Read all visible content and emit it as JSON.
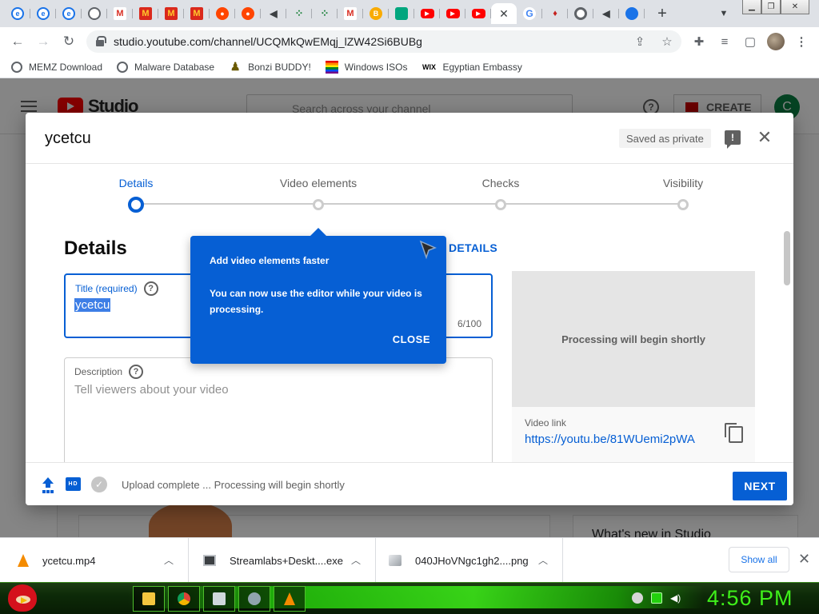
{
  "browser": {
    "tabs": [
      {
        "icon": "ie-icon"
      },
      {
        "icon": "ie-icon"
      },
      {
        "icon": "ie-icon"
      },
      {
        "icon": "globe-icon"
      },
      {
        "icon": "gmail-icon"
      },
      {
        "icon": "mcdonalds-icon"
      },
      {
        "icon": "mcdonalds-icon"
      },
      {
        "icon": "mcdonalds-icon"
      },
      {
        "icon": "reddit-icon"
      },
      {
        "icon": "reddit-icon"
      },
      {
        "icon": "speaker-icon"
      },
      {
        "icon": "grid-icon"
      },
      {
        "icon": "grid-icon"
      },
      {
        "icon": "gmail-icon"
      },
      {
        "icon": "bonzi-icon"
      },
      {
        "icon": "bot-icon"
      },
      {
        "icon": "youtube-icon"
      },
      {
        "icon": "youtube-icon"
      },
      {
        "icon": "youtube-icon"
      },
      {
        "icon": "close-icon",
        "active": true
      },
      {
        "icon": "google-icon"
      },
      {
        "icon": "pin-icon"
      },
      {
        "icon": "chrome-icon"
      },
      {
        "icon": "speaker-icon"
      },
      {
        "icon": "blue-circle-icon"
      }
    ],
    "url": "studio.youtube.com/channel/UCQMkQwEMqj_lZW42Si6BUBg",
    "bookmarks": [
      {
        "label": "MEMZ Download",
        "icon": "globe-icon"
      },
      {
        "label": "Malware Database",
        "icon": "globe-icon"
      },
      {
        "label": "Bonzi BUDDY!",
        "icon": "bonzi-icon"
      },
      {
        "label": "Windows ISOs",
        "icon": "windows-icon"
      },
      {
        "label": "Egyptian Embassy",
        "icon": "wix-icon"
      }
    ]
  },
  "studio": {
    "brand": "Studio",
    "search_placeholder": "Search across your channel",
    "create_label": "CREATE",
    "avatar_letter": "C",
    "whats_new": "What's new in Studio"
  },
  "dialog": {
    "title": "ycetcu",
    "saved_status": "Saved as private",
    "steps": [
      {
        "label": "Details",
        "active": true
      },
      {
        "label": "Video elements",
        "active": false
      },
      {
        "label": "Checks",
        "active": false
      },
      {
        "label": "Visibility",
        "active": false
      }
    ],
    "section_title": "Details",
    "reuse_link": "DETAILS",
    "title_field": {
      "label": "Title (required)",
      "value": "ycetcu",
      "counter": "6/100"
    },
    "description_field": {
      "label": "Description",
      "placeholder": "Tell viewers about your video"
    },
    "preview": {
      "processing_text": "Processing will begin shortly",
      "video_link_label": "Video link",
      "video_link": "https://youtu.be/81WUemi2pWA"
    },
    "footer": {
      "status": "Upload complete ... Processing will begin shortly",
      "next_label": "NEXT"
    }
  },
  "tooltip": {
    "title": "Add video elements faster",
    "body": "You can now use the editor while your video is processing.",
    "close_label": "CLOSE"
  },
  "downloads": {
    "items": [
      {
        "name": "ycetcu.mp4",
        "icon": "vlc-icon"
      },
      {
        "name": "Streamlabs+Deskt....exe",
        "icon": "exe-icon"
      },
      {
        "name": "040JHoVNgc1gh2....png",
        "icon": "image-file-icon"
      }
    ],
    "show_all_label": "Show all"
  },
  "taskbar": {
    "clock": "4:56 PM"
  },
  "colors": {
    "accent": "#065fd4",
    "youtube_red": "#ff0000",
    "taskbar_green": "#3ff01a"
  }
}
